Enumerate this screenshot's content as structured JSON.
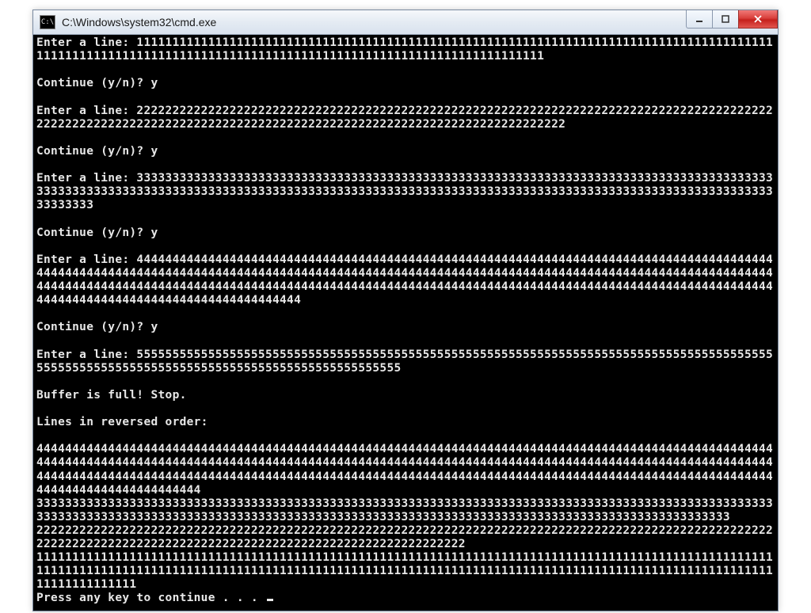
{
  "window": {
    "icon_text": "C:\\",
    "title": "C:\\Windows\\system32\\cmd.exe"
  },
  "console": {
    "prompt_enter": "Enter a line: ",
    "prompt_continue": "Continue (y/n)? ",
    "continue_answer": "y",
    "buffer_full": "Buffer is full! Stop.",
    "reversed_header": "Lines in reversed order:",
    "press_any_key": "Press any key to continue . . . ",
    "entries": [
      {
        "digit": "1",
        "count": 160
      },
      {
        "digit": "2",
        "count": 163
      },
      {
        "digit": "3",
        "count": 200
      },
      {
        "digit": "4",
        "count": 332
      },
      {
        "digit": "5",
        "count": 140
      }
    ],
    "reversed": [
      {
        "digit": "4",
        "count": 332
      },
      {
        "digit": "3",
        "count": 200
      },
      {
        "digit": "2",
        "count": 163
      },
      {
        "digit": "1",
        "count": 220
      }
    ]
  }
}
